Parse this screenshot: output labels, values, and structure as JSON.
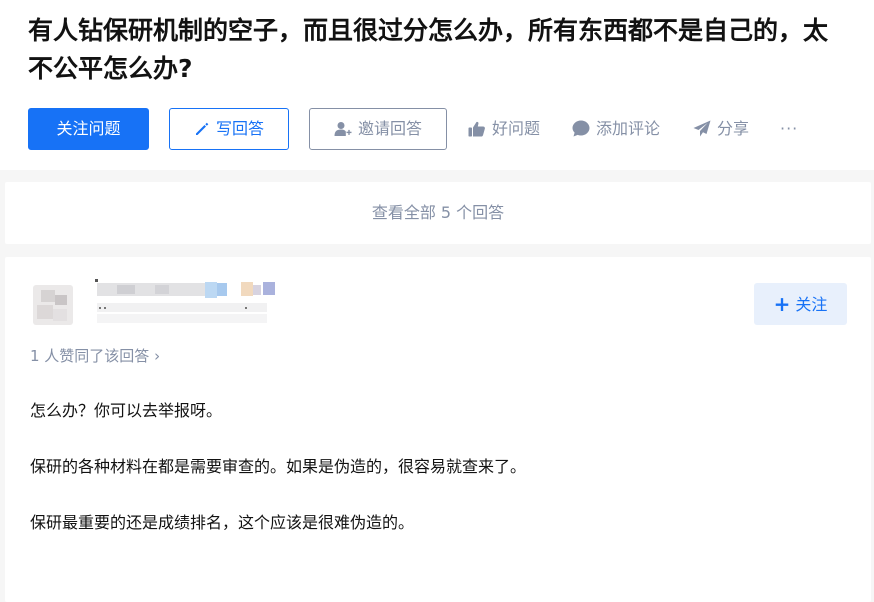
{
  "question": {
    "title": "有人钻保研机制的空子，而且很过分怎么办，所有东西都不是自己的，太不公平怎么办?"
  },
  "actions": {
    "follow_question": "关注问题",
    "write_answer": "写回答",
    "invite_answer": "邀请回答",
    "good_question": "好问题",
    "add_comment": "添加评论",
    "share": "分享",
    "more": "···"
  },
  "view_all": "查看全部 5 个回答",
  "answer_card": {
    "follow_user": "关注",
    "votes_text": "1 人赞同了该回答 ›",
    "paragraphs": [
      "怎么办？你可以去举报呀。",
      "保研的各种材料在都是需要审查的。如果是伪造的，很容易就查来了。",
      "保研最重要的还是成绩排名，这个应该是很难伪造的。"
    ]
  },
  "colors": {
    "brand_blue": "#1772f6",
    "muted_gray": "#8590a6",
    "follow_user_bg": "#e8f0fc"
  }
}
